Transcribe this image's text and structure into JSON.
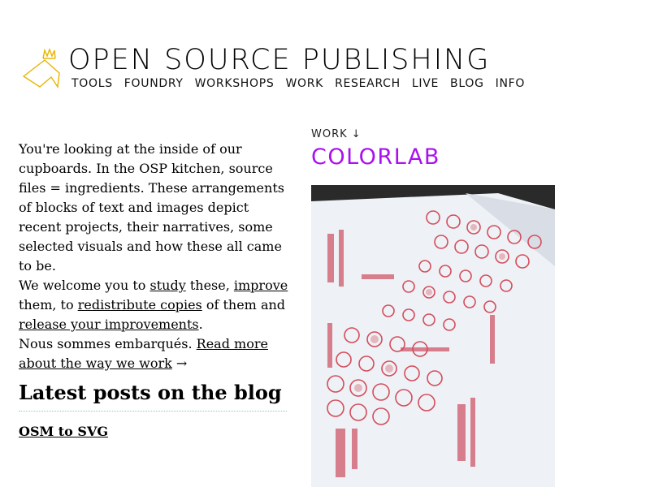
{
  "site": {
    "title": "OPEN SOURCE PUBLISHING"
  },
  "nav": [
    "TOOLS",
    "FOUNDRY",
    "WORKSHOPS",
    "WORK",
    "RESEARCH",
    "LIVE",
    "BLOG",
    "INFO"
  ],
  "intro": {
    "line1": "You're looking at the inside of our cupboards. In the OSP kitchen, source files = ingredients. These arrangements of blocks of text and images depict recent projects, their narratives, some selected visuals and how these all came to be.",
    "welcome_prefix": "We welcome you to ",
    "link_study": "study",
    "sep1": " these, ",
    "link_improve": "improve",
    "sep2": " them, to ",
    "link_redistribute": "redistribute copies",
    "sep3": " of them and ",
    "link_release": "release your improvements",
    "sep4": ".",
    "french_prefix": "Nous sommes embarqués. ",
    "link_readmore": "Read more about the way we work",
    "arrow": " →"
  },
  "blog": {
    "heading": "Latest posts on the blog",
    "posts": [
      "OSM to SVG"
    ]
  },
  "project": {
    "kicker": "WORK ↓",
    "title": "COLORLAB"
  },
  "colors": {
    "accent": "#aa11ee",
    "logo": "#e8b400",
    "divider": "#7fd3b5"
  }
}
